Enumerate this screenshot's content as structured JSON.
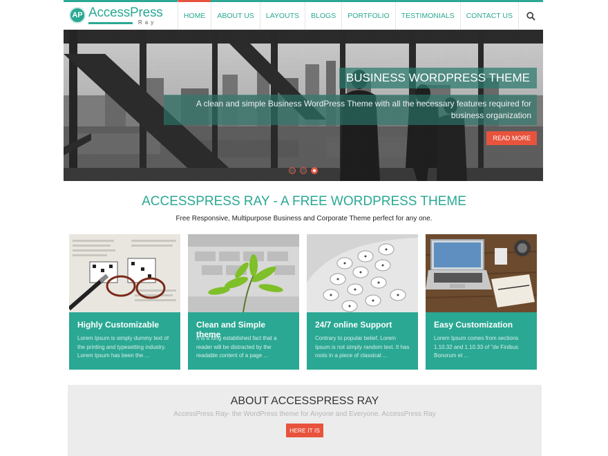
{
  "brand": {
    "badge": "AP",
    "name": "AccessPress",
    "sub": "Ray"
  },
  "nav": {
    "items": [
      {
        "label": "HOME"
      },
      {
        "label": "ABOUT US"
      },
      {
        "label": "LAYOUTS"
      },
      {
        "label": "BLOGS"
      },
      {
        "label": "PORTFOLIO"
      },
      {
        "label": "TESTIMONIALS"
      },
      {
        "label": "CONTACT US"
      }
    ],
    "active": "HOME",
    "search_icon": "search-icon"
  },
  "slider": {
    "title": "BUSINESS WORDPRESS THEME",
    "text": "A clean and simple Business WordPress Theme with all the necessary features required for business organization",
    "button": "READ MORE",
    "slides_count": 3,
    "active_slide": 3
  },
  "intro": {
    "title": "ACCESSPRESS RAY - A FREE WORDPRESS THEME",
    "subtitle": "Free Responsive, Multipurpose Business and Corporate Theme perfect for any one."
  },
  "features": [
    {
      "title": "Highly Customizable",
      "text": "Lorem Ipsum is simply dummy text of the printing and typesetting industry. Lorem Ipsum has been the ...",
      "image": "newspaper-glasses"
    },
    {
      "title": "Clean and Simple theme",
      "text": "It is a long established fact that a reader will be distracted by the readable content of a page ...",
      "image": "plant-keyboard"
    },
    {
      "title": "24/7 online Support",
      "text": "Contrary to popular belief, Lorem Ipsum is not simply random text. It has roots in a piece of classical ...",
      "image": "telephone-keypad"
    },
    {
      "title": "Easy Customization",
      "text": "Lorem Ipsum comes from sections 1.10.32 and 1.10.33 of \"de Finibus Bonorum et ...",
      "image": "laptop-desk"
    }
  ],
  "about": {
    "title": "ABOUT ACCESSPRESS RAY",
    "text": "AccessPress Ray- the WordPress theme for Anyone and Everyone. AccessPress Ray",
    "button": "HERE IT IS"
  },
  "colors": {
    "accent": "#2aa893",
    "button": "#e8533d",
    "about_bg": "#ececec"
  }
}
